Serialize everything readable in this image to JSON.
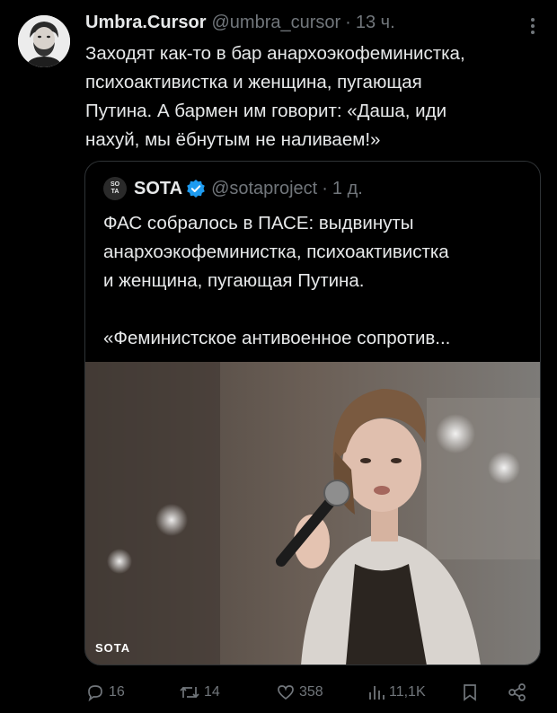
{
  "author": {
    "name": "Umbra.Cursor",
    "handle": "@umbra_cursor",
    "separator": "·",
    "time": "13 ч."
  },
  "tweet_text": "Заходят как-то в бар анархоэкофеминистка,\nпсихоактивистка и женщина, пугающая\nПутина. А бармен им говорит: «Даша, иди\nнахуй, мы ёбнутым не наливаем!»",
  "quote": {
    "logo_line1": "SO",
    "logo_line2": "TA",
    "name": "SOTA",
    "handle": "@sotaproject",
    "separator": "·",
    "time": "1 д.",
    "text": "ФАС собралось в ПАСЕ: выдвинуты\nанархоэкофеминистка, психоактивистка\nи женщина, пугающая Путина.\n\n«Феминистское антивоенное сопротив...",
    "photo_watermark": "SOTA"
  },
  "actions": {
    "replies": "16",
    "reposts": "14",
    "likes": "358",
    "views": "11,1K"
  },
  "colors": {
    "background": "#000000",
    "text": "#e7e9ea",
    "muted": "#71767b",
    "verified": "#1d9bf0",
    "border": "#2f3336"
  }
}
